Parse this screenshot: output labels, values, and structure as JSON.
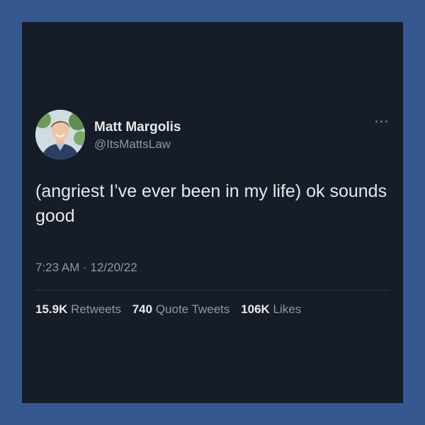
{
  "tweet": {
    "author_name": "Matt Margolis",
    "author_handle": "@ItsMattsLaw",
    "text": "(angriest I’ve ever been in my life) ok sounds good",
    "time": "7:23 AM",
    "separator": "·",
    "date": "12/20/22",
    "stats": {
      "retweets_count": "15.9K",
      "retweets_label": "Retweets",
      "quotes_count": "740",
      "quotes_label": "Quote Tweets",
      "likes_count": "106K",
      "likes_label": "Likes"
    },
    "more_icon": "more-horizontal-icon"
  },
  "colors": {
    "frame": "#35588f",
    "card_background": "#161d28",
    "primary_text": "#e7e9ea",
    "secondary_text": "#8b98a5"
  }
}
